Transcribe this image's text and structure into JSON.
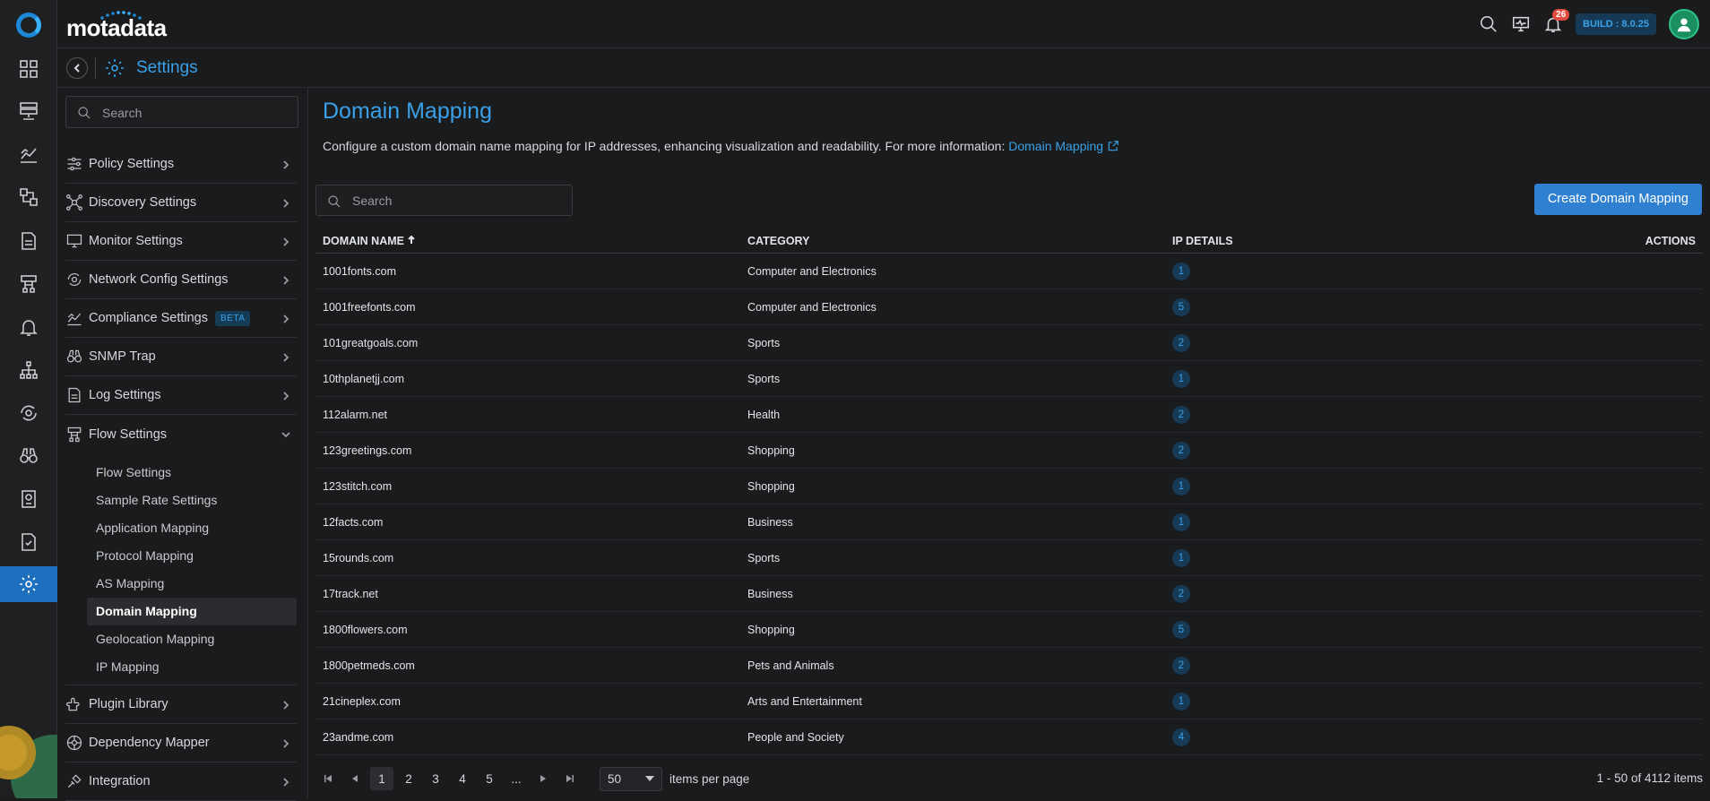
{
  "app": {
    "brand": "motadata",
    "build": "BUILD : 8.0.25",
    "notification_count": "26"
  },
  "colors": {
    "accent": "#3aa0e8",
    "primary_button": "#2f80d0",
    "badge": "#e04b3e"
  },
  "rail": {
    "icons": [
      "logo-icon",
      "dashboard-icon",
      "server-icon",
      "metrics-icon",
      "topology-icon",
      "reports-icon",
      "flow-icon",
      "alerts-icon",
      "network-icon",
      "config-icon",
      "binoculars-icon",
      "audit-icon",
      "compliance-icon",
      "settings-icon"
    ]
  },
  "subbar": {
    "title": "Settings"
  },
  "sidebar": {
    "search_placeholder": "Search",
    "items": [
      {
        "label": "Policy Settings",
        "icon": "sliders-icon"
      },
      {
        "label": "Discovery Settings",
        "icon": "discovery-icon"
      },
      {
        "label": "Monitor Settings",
        "icon": "monitor-icon"
      },
      {
        "label": "Network Config Settings",
        "icon": "network-config-icon"
      },
      {
        "label": "Compliance Settings",
        "icon": "compliance-icon",
        "badge": "BETA"
      },
      {
        "label": "SNMP Trap",
        "icon": "binoculars-icon"
      },
      {
        "label": "Log Settings",
        "icon": "log-icon"
      },
      {
        "label": "Flow Settings",
        "icon": "flow-icon"
      }
    ],
    "flow_sub": [
      "Flow Settings",
      "Sample Rate Settings",
      "Application Mapping",
      "Protocol Mapping",
      "AS Mapping",
      "Domain Mapping",
      "Geolocation Mapping",
      "IP Mapping"
    ],
    "bottom_items": [
      {
        "label": "Plugin Library",
        "icon": "plugin-icon"
      },
      {
        "label": "Dependency Mapper",
        "icon": "dependency-icon"
      },
      {
        "label": "Integration",
        "icon": "integration-icon"
      }
    ]
  },
  "main": {
    "title": "Domain Mapping",
    "description": "Configure a custom domain name mapping for IP addresses, enhancing visualization and readability. For more information:",
    "link_text": "Domain Mapping",
    "search_placeholder": "Search",
    "create_button": "Create Domain Mapping",
    "columns": [
      "DOMAIN NAME",
      "CATEGORY",
      "IP DETAILS",
      "ACTIONS"
    ],
    "rows": [
      {
        "domain": "1001fonts.com",
        "category": "Computer and Electronics",
        "ip": "1"
      },
      {
        "domain": "1001freefonts.com",
        "category": "Computer and Electronics",
        "ip": "5"
      },
      {
        "domain": "101greatgoals.com",
        "category": "Sports",
        "ip": "2"
      },
      {
        "domain": "10thplanetjj.com",
        "category": "Sports",
        "ip": "1"
      },
      {
        "domain": "112alarm.net",
        "category": "Health",
        "ip": "2"
      },
      {
        "domain": "123greetings.com",
        "category": "Shopping",
        "ip": "2"
      },
      {
        "domain": "123stitch.com",
        "category": "Shopping",
        "ip": "1"
      },
      {
        "domain": "12facts.com",
        "category": "Business",
        "ip": "1"
      },
      {
        "domain": "15rounds.com",
        "category": "Sports",
        "ip": "1"
      },
      {
        "domain": "17track.net",
        "category": "Business",
        "ip": "2"
      },
      {
        "domain": "1800flowers.com",
        "category": "Shopping",
        "ip": "5"
      },
      {
        "domain": "1800petmeds.com",
        "category": "Pets and Animals",
        "ip": "2"
      },
      {
        "domain": "21cineplex.com",
        "category": "Arts and Entertainment",
        "ip": "1"
      },
      {
        "domain": "23andme.com",
        "category": "People and Society",
        "ip": "4"
      }
    ],
    "pager": {
      "pages": [
        "1",
        "2",
        "3",
        "4",
        "5",
        "..."
      ],
      "per_page": "50",
      "per_page_label": "items per page",
      "total": "1 - 50 of 4112 items"
    }
  }
}
